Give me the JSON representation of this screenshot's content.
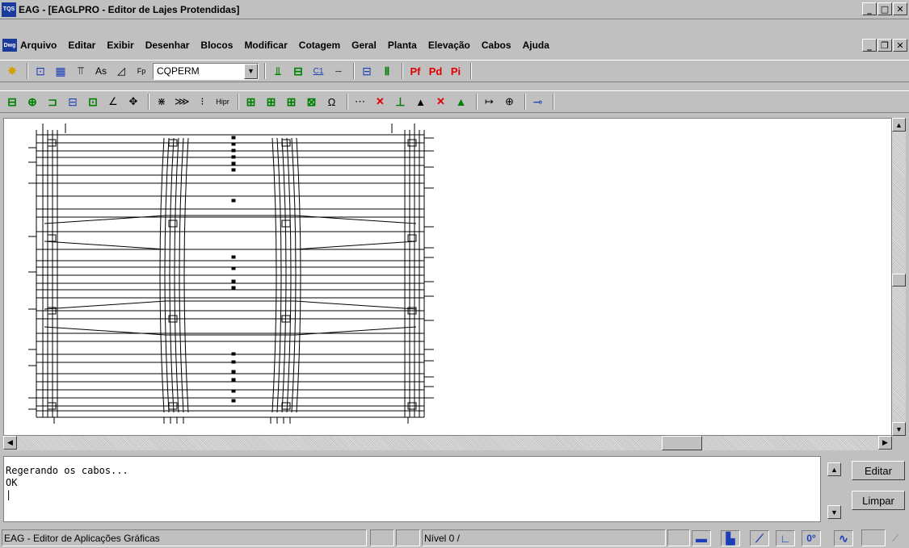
{
  "window": {
    "title": "EAG - [EAGLPRO - Editor de Lajes Protendidas]",
    "app_icon_text": "TQS",
    "doc_icon_text": "Dwg"
  },
  "menu": [
    "Arquivo",
    "Editar",
    "Exibir",
    "Desenhar",
    "Blocos",
    "Modificar",
    "Cotagem",
    "Geral",
    "Planta",
    "Elevação",
    "Cabos",
    "Ajuda"
  ],
  "toolbar1": {
    "combo_value": "CQPERM",
    "as_label": "As",
    "fp_label": "Fp",
    "c1_label": "C1",
    "pf_label": "Pf",
    "pd_label": "Pd",
    "pi_label": "Pi"
  },
  "toolbar2": {
    "hipr_label": "Hipr"
  },
  "command": {
    "lines": [
      "Regerando os cabos...",
      "OK",
      "|"
    ]
  },
  "buttons": {
    "editar": "Editar",
    "limpar": "Limpar"
  },
  "status": {
    "app_text": "EAG - Editor de Aplicações Gráficas",
    "level": "Nível 0 /",
    "angle": "0°"
  }
}
